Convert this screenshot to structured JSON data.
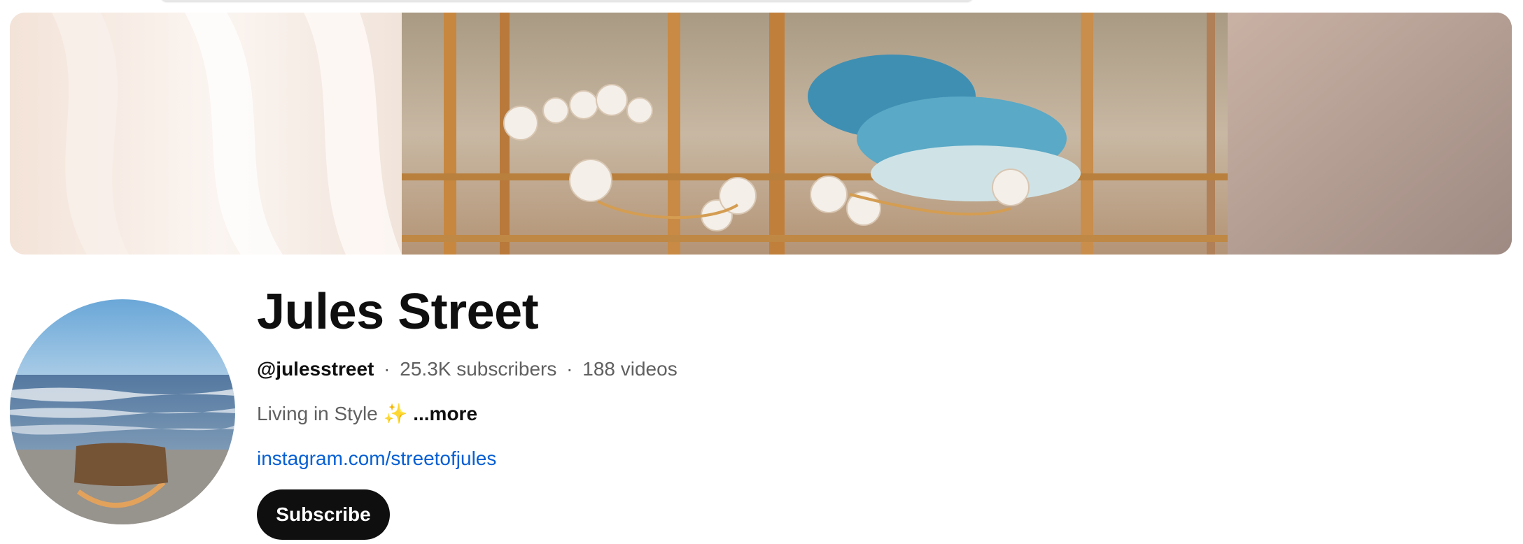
{
  "channel": {
    "name": "Jules Street",
    "handle": "@julesstreet",
    "subscribers": "25.3K subscribers",
    "videos": "188 videos",
    "separator": "·",
    "description": "Living in Style",
    "description_emoji": "✨",
    "more_label": "...more",
    "link": "instagram.com/streetofjules",
    "subscribe_label": "Subscribe"
  },
  "colors": {
    "link": "#065fd4",
    "subscribe_bg": "#0f0f0f",
    "text_primary": "#0f0f0f",
    "text_secondary": "#606060"
  },
  "icons": {
    "banner": "jewelry-display-banner-image",
    "avatar": "beach-handbag-avatar-image"
  }
}
